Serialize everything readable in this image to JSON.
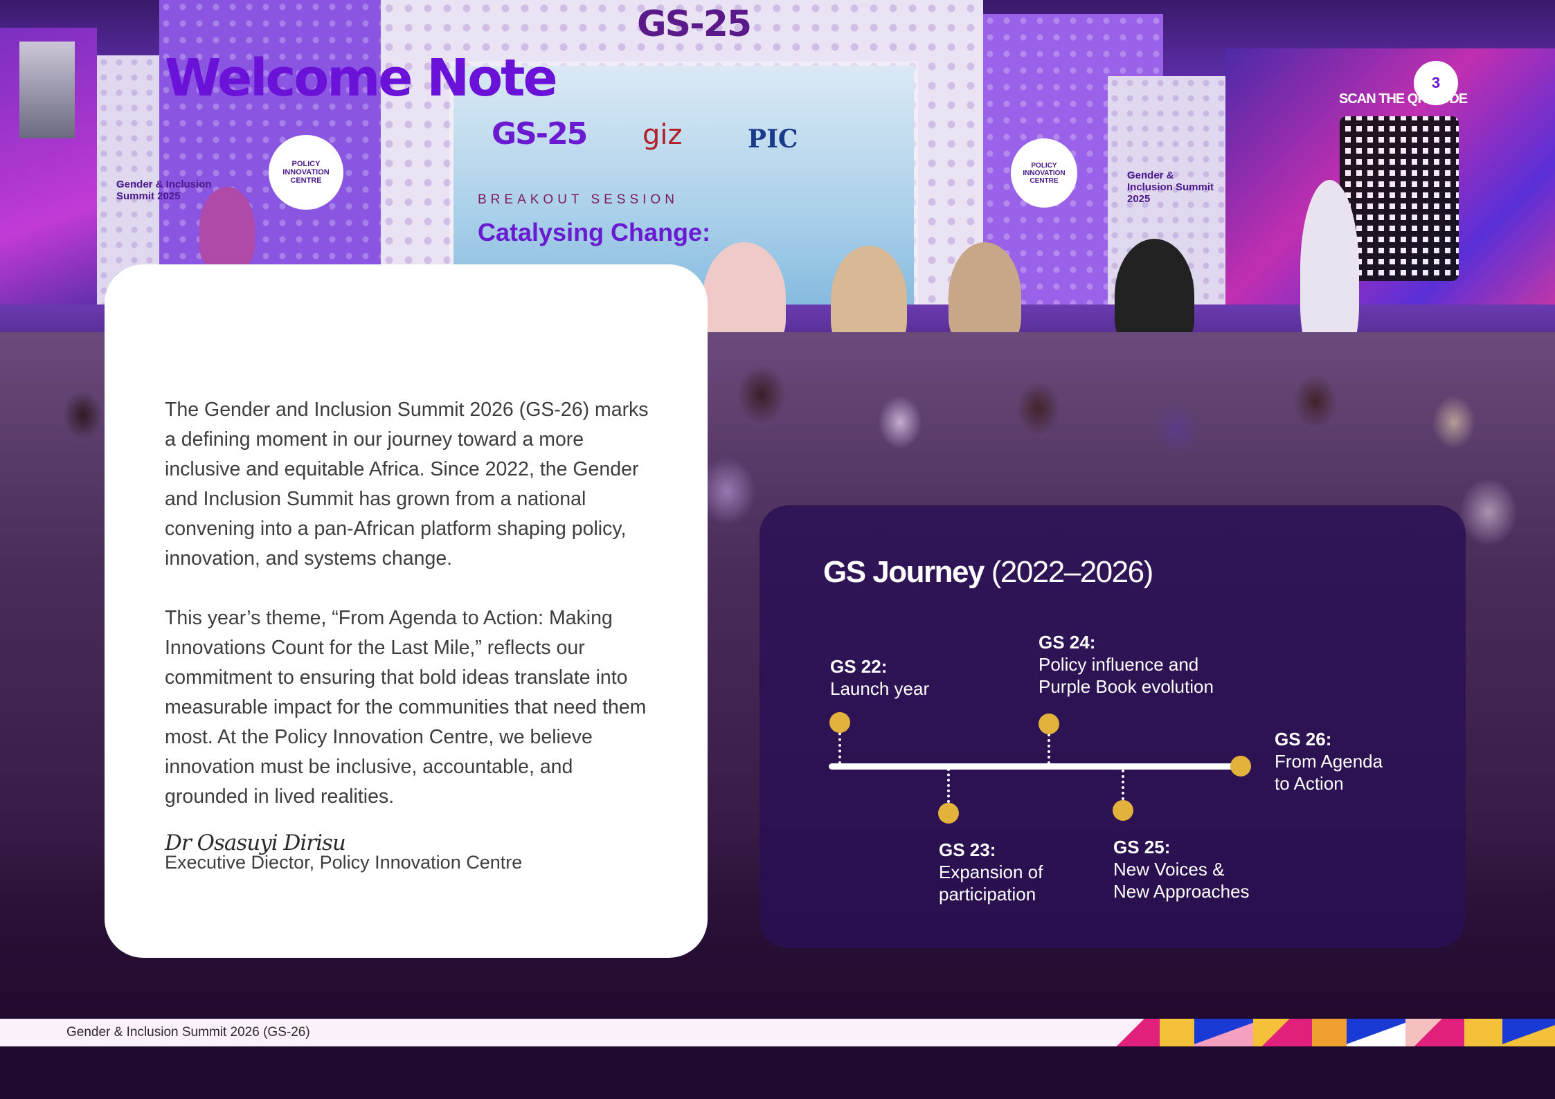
{
  "page": {
    "number": "3"
  },
  "welcome": {
    "title": "Welcome Note",
    "paragraphs": [
      "The Gender and Inclusion Summit 2026 (GS-26) marks a defining moment in our journey toward a more inclusive and equitable Africa. Since 2022, the Gender and Inclusion Summit has grown from a national convening into a pan-African platform shaping policy, innovation, and systems change.",
      "This year’s theme, “From Agenda to Action: Making Innovations Count for the Last Mile,” reflects our commitment to ensuring that bold ideas translate into measurable impact for the communities that need them most. At the Policy Innovation Centre, we believe innovation must be inclusive, accountable, and grounded in lived realities."
    ],
    "signature": "Dr Osasuyi Dirisu",
    "signature_role": "Executive Diector, Policy Innovation Centre"
  },
  "journey": {
    "title_strong": "GS Journey",
    "title_rest": "(2022–2026)",
    "milestones": [
      {
        "year": "GS 22:",
        "lines": [
          "Launch year"
        ]
      },
      {
        "year": "GS 23:",
        "lines": [
          "Expansion of",
          "participation"
        ]
      },
      {
        "year": "GS 24:",
        "lines": [
          "Policy influence and",
          "Purple Book evolution"
        ]
      },
      {
        "year": "GS 25:",
        "lines": [
          "New Voices &",
          "New Approaches"
        ]
      },
      {
        "year": "GS 26:",
        "lines": [
          "From Agenda",
          "to Action"
        ]
      }
    ],
    "accent_color": "#e2b23d"
  },
  "footer": {
    "text": "Gender & Inclusion Summit 2026 (GS-26)"
  },
  "photo": {
    "stage_signs": [
      "GS-25",
      "GS-25",
      "giz",
      "PIC",
      "BREAKOUT SESSION",
      "Catalysing Change:",
      "SCAN THE QR CODE",
      "POLICY INNOVATION CENTRE",
      "POLICY INNOVATION CENTRE",
      "Gender & Inclusion Summit 2025",
      "Gender & Inclusion Summit 2025"
    ]
  },
  "colors": {
    "title_purple": "#6a12d8",
    "panel": "#2a1054",
    "footer_bg": "#fbf1fb"
  }
}
